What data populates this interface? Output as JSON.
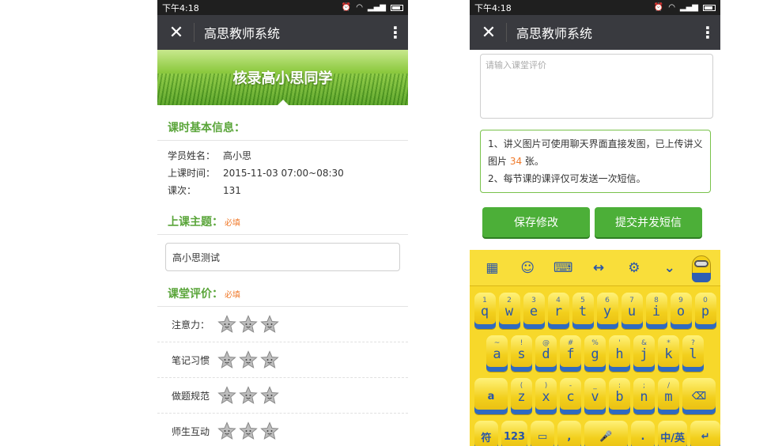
{
  "status": {
    "time": "下午4:18"
  },
  "header": {
    "title": "高思教师系统"
  },
  "left": {
    "banner": "核录高小思同学",
    "basic_title": "课时基本信息：",
    "info": [
      {
        "key": "学员姓名：",
        "value": "高小思"
      },
      {
        "key": "上课时间：",
        "value": "2015-11-03 07:00~08:30"
      },
      {
        "key": "课次：",
        "value": "131"
      }
    ],
    "topic_title": "上课主题：",
    "required": "必填",
    "topic_value": "高小思测试",
    "eval_title": "课堂评价：",
    "ratings": [
      {
        "label": "注意力：",
        "stars": 3
      },
      {
        "label": "笔记习惯",
        "stars": 3
      },
      {
        "label": "做题规范",
        "stars": 3
      },
      {
        "label": "师生互动",
        "stars": 3
      }
    ]
  },
  "right": {
    "textarea_placeholder": "请输入课堂评价",
    "notice_line1_a": "1、讲义图片可使用聊天界面直接发图，已上传讲义图片 ",
    "notice_count": "34",
    "notice_line1_b": " 张。",
    "notice_line2": "2、每节课的课评仅可发送一次短信。",
    "save_button": "保存修改",
    "submit_button": "提交并发短信"
  },
  "keyboard": {
    "toolbar_icons": [
      "apps-icon",
      "emoji-icon",
      "keyboard-icon",
      "cursor-icon",
      "settings-icon",
      "collapse-icon"
    ],
    "row1": [
      {
        "ch": "q",
        "sym": "1"
      },
      {
        "ch": "w",
        "sym": "2"
      },
      {
        "ch": "e",
        "sym": "3"
      },
      {
        "ch": "r",
        "sym": "4"
      },
      {
        "ch": "t",
        "sym": "5"
      },
      {
        "ch": "y",
        "sym": "6"
      },
      {
        "ch": "u",
        "sym": "7"
      },
      {
        "ch": "i",
        "sym": "8"
      },
      {
        "ch": "o",
        "sym": "9"
      },
      {
        "ch": "p",
        "sym": "0"
      }
    ],
    "row2": [
      {
        "ch": "a",
        "sym": "~"
      },
      {
        "ch": "s",
        "sym": "!"
      },
      {
        "ch": "d",
        "sym": "@"
      },
      {
        "ch": "f",
        "sym": "#"
      },
      {
        "ch": "g",
        "sym": "%"
      },
      {
        "ch": "h",
        "sym": "'"
      },
      {
        "ch": "j",
        "sym": "&"
      },
      {
        "ch": "k",
        "sym": "*"
      },
      {
        "ch": "l",
        "sym": "?"
      }
    ],
    "row3": [
      {
        "ch": "z",
        "sym": "("
      },
      {
        "ch": "x",
        "sym": ")"
      },
      {
        "ch": "c",
        "sym": "-"
      },
      {
        "ch": "v",
        "sym": "_"
      },
      {
        "ch": "b",
        "sym": ":"
      },
      {
        "ch": "n",
        "sym": ";"
      },
      {
        "ch": "m",
        "sym": "/"
      }
    ],
    "shift": "a",
    "symbols": "符",
    "numbers": "123",
    "comma": ",",
    "period": ".",
    "lang": "中/英"
  }
}
